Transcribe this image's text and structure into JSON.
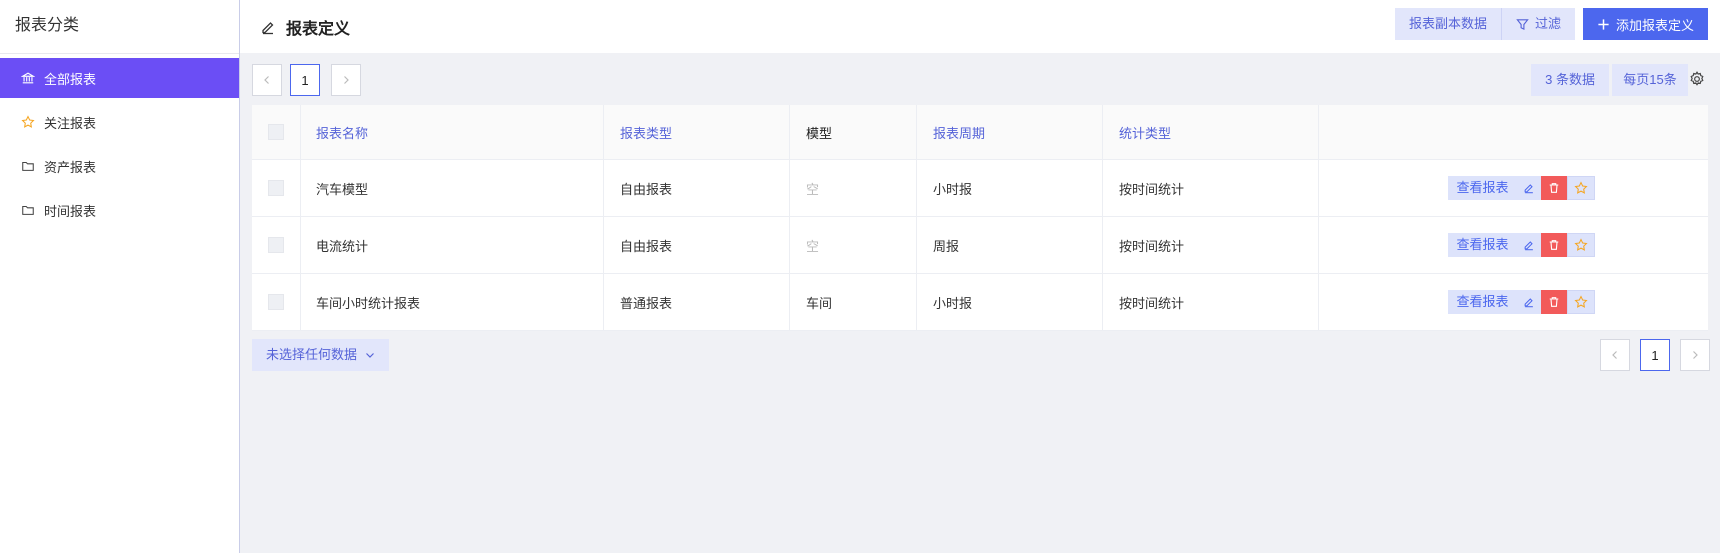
{
  "sidebar": {
    "title": "报表分类",
    "items": [
      {
        "label": "全部报表",
        "icon": "bank-icon"
      },
      {
        "label": "关注报表",
        "icon": "star-icon"
      },
      {
        "label": "资产报表",
        "icon": "folder-icon"
      },
      {
        "label": "时间报表",
        "icon": "folder-icon"
      }
    ]
  },
  "header": {
    "title": "报表定义",
    "copy_data_label": "报表副本数据",
    "filter_label": "过滤",
    "add_label": "添加报表定义"
  },
  "toolbar": {
    "current_page": "1",
    "count_label": "3 条数据",
    "per_page_label": "每页15条"
  },
  "table": {
    "columns": [
      "报表名称",
      "报表类型",
      "模型",
      "报表周期",
      "统计类型"
    ],
    "rows": [
      {
        "name": "汽车模型",
        "type": "自由报表",
        "model": "空",
        "period": "小时报",
        "stat": "按时间统计"
      },
      {
        "name": "电流统计",
        "type": "自由报表",
        "model": "空",
        "period": "周报",
        "stat": "按时间统计"
      },
      {
        "name": "车间小时统计报表",
        "type": "普通报表",
        "model": "车间",
        "period": "小时报",
        "stat": "按时间统计"
      }
    ],
    "view_label": "查看报表"
  },
  "footer": {
    "selection_label": "未选择任何数据",
    "current_page": "1"
  },
  "colors": {
    "accent": "#6b4ef5",
    "primary": "#4c67ee",
    "danger": "#f25a5a",
    "star": "#f5a623"
  }
}
